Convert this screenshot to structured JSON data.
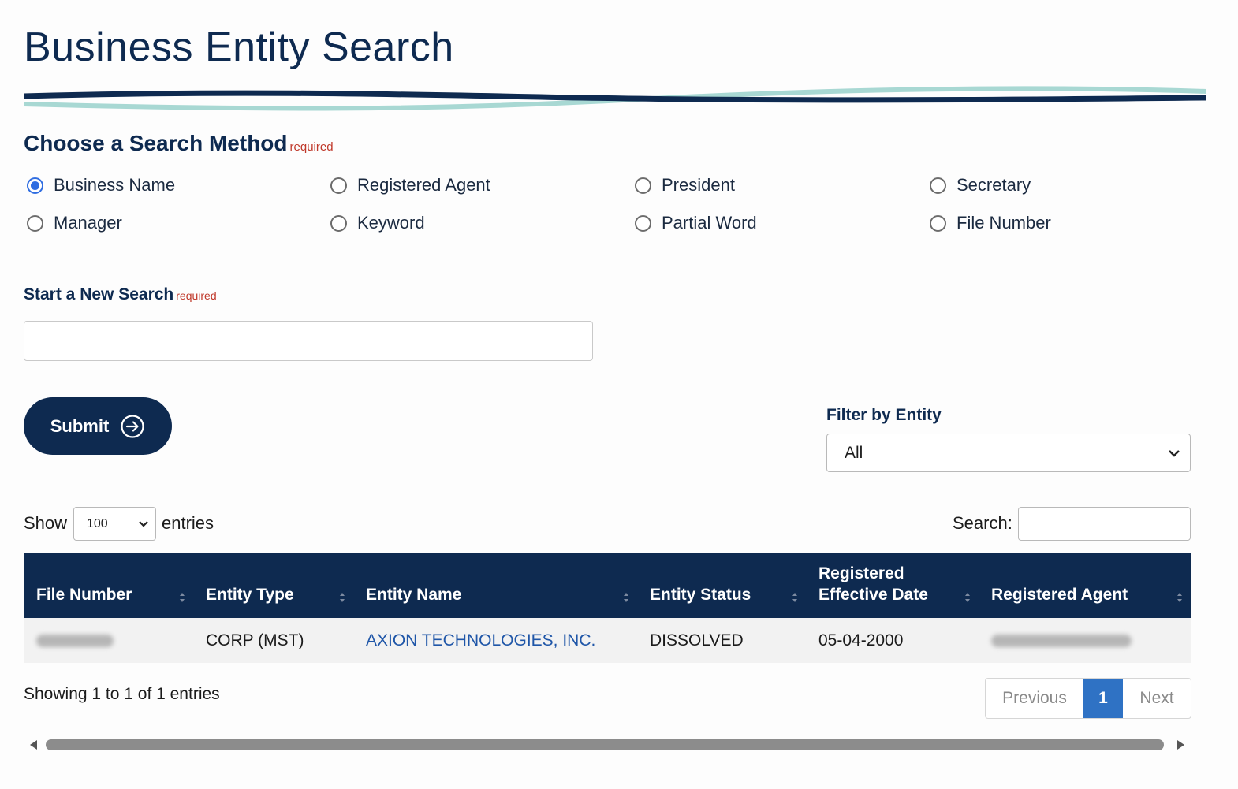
{
  "page": {
    "title": "Business Entity Search"
  },
  "search_method": {
    "label": "Choose a Search Method",
    "required_text": "required",
    "selected": "Business Name",
    "options": [
      "Business Name",
      "Registered Agent",
      "President",
      "Secretary",
      "Manager",
      "Keyword",
      "Partial Word",
      "File Number"
    ]
  },
  "new_search": {
    "label": "Start a New Search",
    "required_text": "required",
    "value": ""
  },
  "submit": {
    "label": "Submit"
  },
  "filter": {
    "label": "Filter by Entity",
    "selected": "All"
  },
  "table_controls": {
    "show_label": "Show",
    "entries_value": "100",
    "entries_label": "entries",
    "search_label": "Search:",
    "search_value": ""
  },
  "table": {
    "headers": [
      "File Number",
      "Entity Type",
      "Entity Name",
      "Entity Status",
      "Registered Effective Date",
      "Registered Agent"
    ],
    "rows": [
      {
        "entity_type": "CORP (MST)",
        "entity_name": "AXION TECHNOLOGIES, INC.",
        "entity_status": "DISSOLVED",
        "effective_date": "05-04-2000"
      }
    ]
  },
  "footer": {
    "showing": "Showing 1 to 1 of 1 entries",
    "previous": "Previous",
    "current_page": "1",
    "next": "Next"
  },
  "colors": {
    "brand_navy": "#0e2a50",
    "accent_teal": "#9fd3cf",
    "link_blue": "#1f56a8",
    "page_active": "#2f72c4",
    "required_red": "#c0392b"
  },
  "icons": {
    "submit": "arrow-right-circle-icon",
    "select": "chevron-down-icon",
    "sort": "sort-icon"
  }
}
